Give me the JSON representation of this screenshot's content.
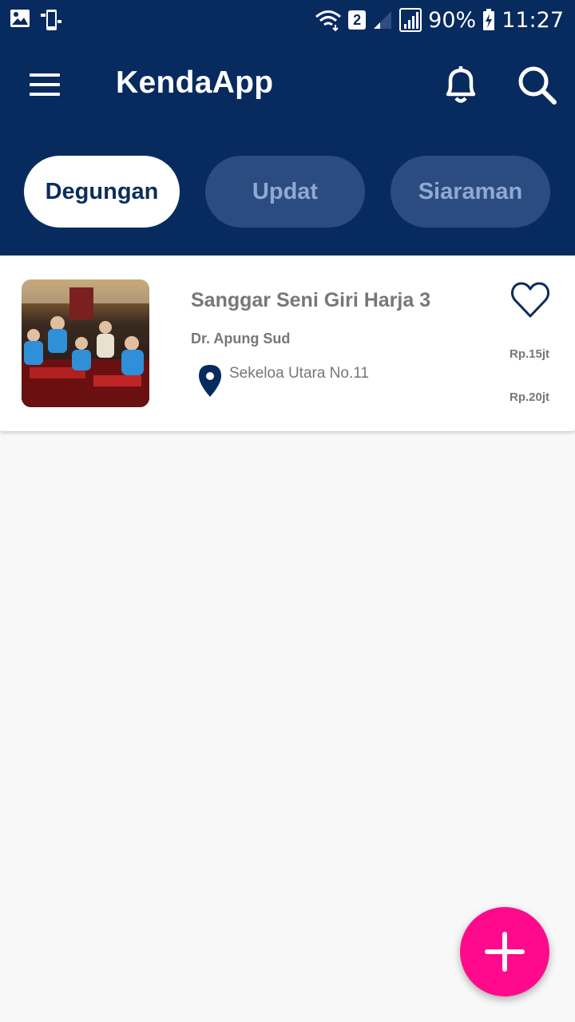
{
  "status_bar": {
    "battery": "90%",
    "time": "11:27",
    "sim_badge": "2",
    "icons": [
      "gallery-icon",
      "phone-sync-icon",
      "wifi-icon",
      "sim-badge",
      "signal-icon",
      "signal-icon",
      "battery-charging-icon"
    ]
  },
  "app_bar": {
    "title": "KendaApp",
    "icons": [
      "menu-icon",
      "bell-icon",
      "search-icon"
    ]
  },
  "tabs": [
    {
      "label": "Degungan",
      "active": true
    },
    {
      "label": "Updat",
      "active": false
    },
    {
      "label": "Siaraman",
      "active": false
    }
  ],
  "listing": {
    "title": "Sanggar Seni Giri Harja 3",
    "owner": "Dr. Apung Sud",
    "address": "Sekeloa Utara No.11",
    "price_min": "Rp.15jt",
    "price_max": "Rp.20jt",
    "icons": [
      "map-pin-icon",
      "heart-icon"
    ]
  },
  "fab": {
    "icon": "plus-icon"
  },
  "colors": {
    "primary": "#072a5f",
    "tab_inactive": "#2a4c80",
    "tab_inactive_text": "#8fa9d4",
    "accent": "#ff0a8c",
    "text_muted": "#777777"
  }
}
